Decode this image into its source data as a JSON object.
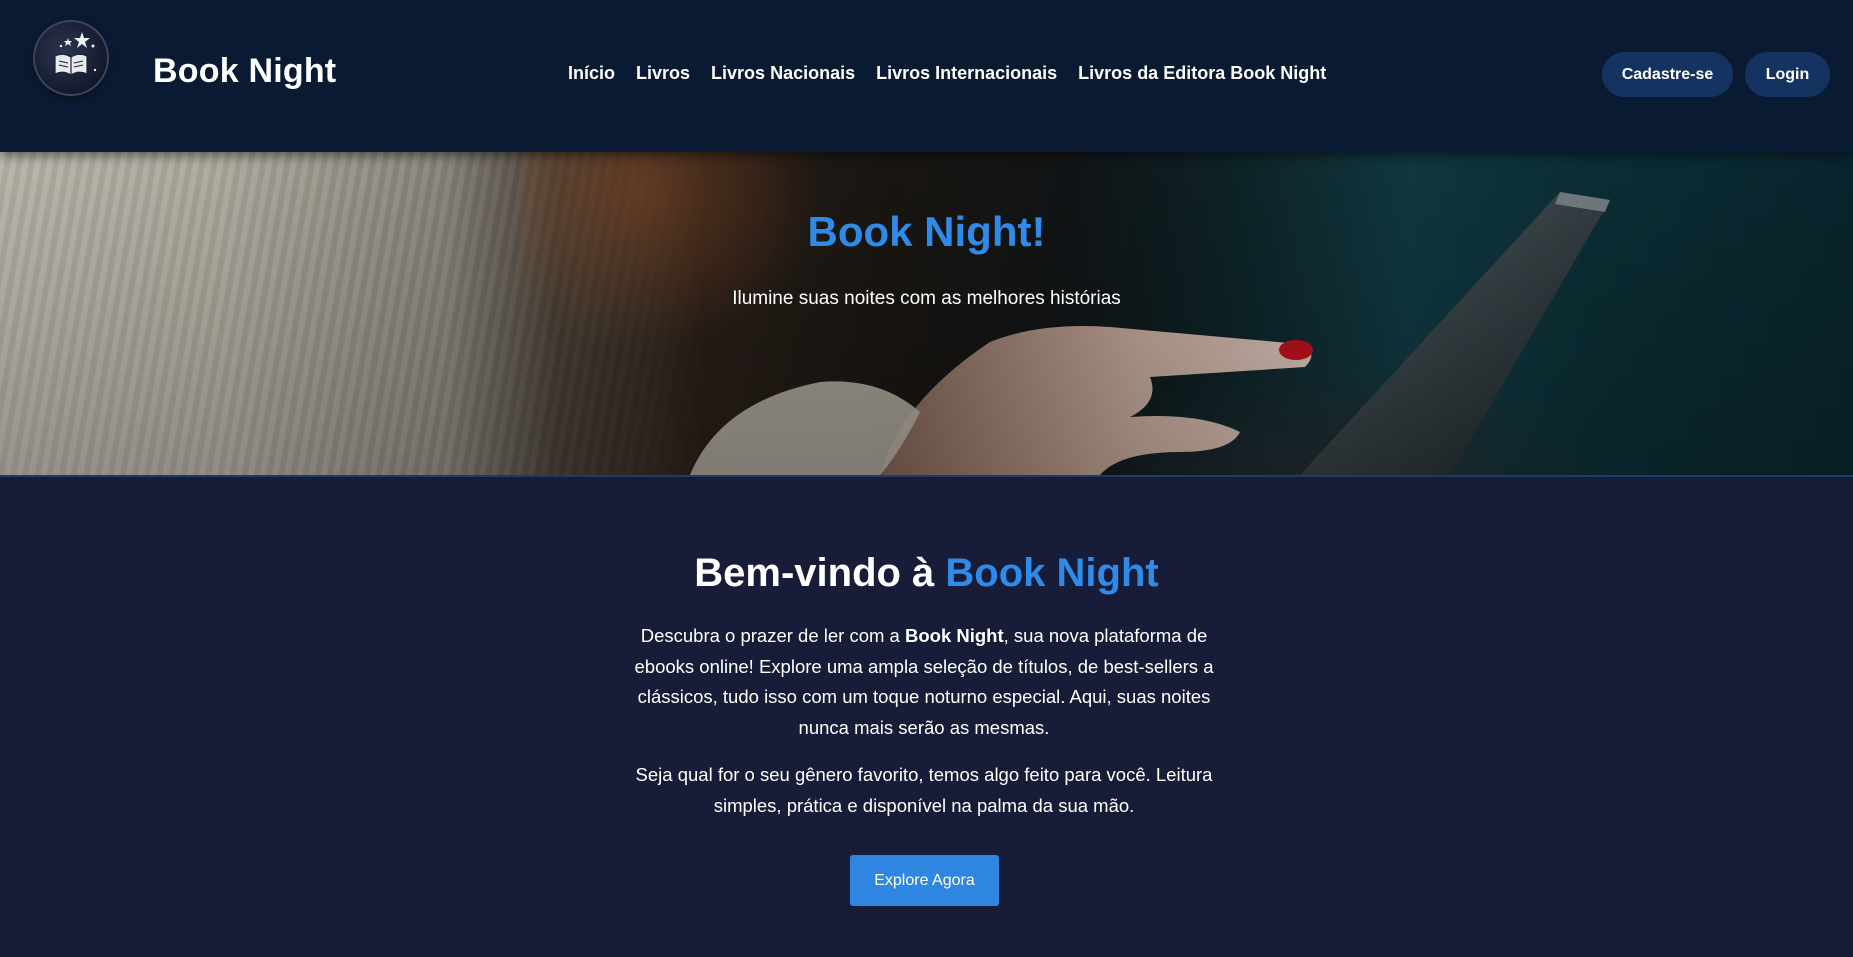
{
  "header": {
    "brand": "Book Night",
    "logo_icon": "moon-book-stars-icon",
    "nav": [
      {
        "label": "Início"
      },
      {
        "label": "Livros"
      },
      {
        "label": "Livros Nacionais"
      },
      {
        "label": "Livros Internacionais"
      },
      {
        "label": "Livros da Editora Book Night"
      }
    ],
    "signup_label": "Cadastre-se",
    "login_label": "Login"
  },
  "hero": {
    "title": "Book Night!",
    "subtitle": "Ilumine suas noites com as melhores histórias"
  },
  "welcome": {
    "title_prefix": "Bem-vindo à ",
    "title_accent": "Book Night",
    "p1_before": "Descubra o prazer de ler com a ",
    "p1_bold": "Book Night",
    "p1_after": ", sua nova plataforma de ebooks online! Explore uma ampla seleção de títulos, de best-sellers a clássicos, tudo isso com um toque noturno especial. Aqui, suas noites nunca mais serão as mesmas.",
    "p2": "Seja qual for o seu gênero favorito, temos algo feito para você. Leitura simples, prática e disponível na palma da sua mão.",
    "cta_label": "Explore Agora"
  },
  "colors": {
    "header_bg": "#0b1a33",
    "page_bg": "#171d38",
    "accent": "#2f8bea",
    "pill_button": "#153360",
    "cta_button": "#2f86e0"
  }
}
